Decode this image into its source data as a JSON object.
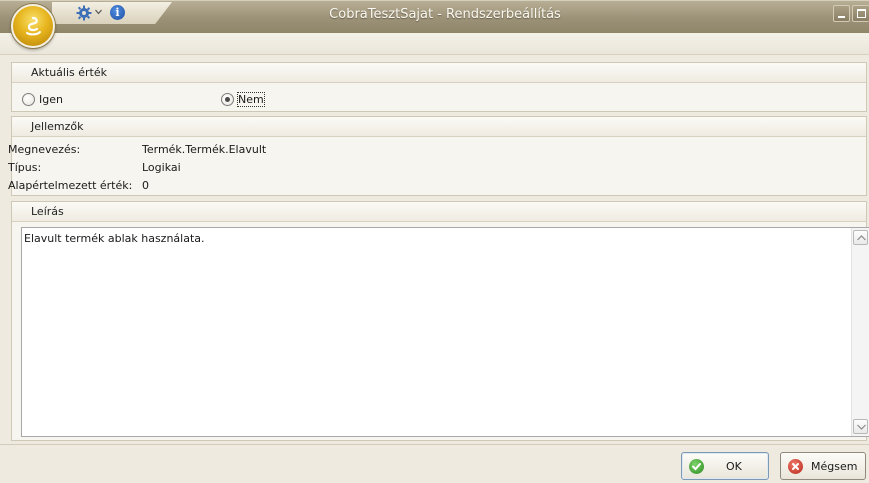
{
  "window": {
    "title": "CobraTesztSajat - Rendszerbeállítás"
  },
  "titlebar": {
    "app_icon": "app-orb-icon",
    "quick_access": [
      "gear-icon",
      "chevron-down-icon",
      "info-icon"
    ],
    "info_glyph": "i"
  },
  "current_value": {
    "header": "Aktuális érték",
    "options": [
      {
        "label": "Igen",
        "selected": false
      },
      {
        "label": "Nem",
        "selected": true
      }
    ]
  },
  "properties": {
    "header": "Jellemzők",
    "rows": [
      {
        "key": "Megnevezés:",
        "value": "Termék.Termék.Elavult"
      },
      {
        "key": "Típus:",
        "value": "Logikai"
      },
      {
        "key": "Alapértelmezett érték:",
        "value": "0"
      }
    ]
  },
  "description": {
    "header": "Leírás",
    "text": "Elavult termék ablak használata."
  },
  "buttons": {
    "ok": "OK",
    "cancel": "Mégsem"
  },
  "colors": {
    "titlebar": "#9c9278",
    "orb": "#e7b51e",
    "ok_icon": "#2d8a23",
    "cancel_icon": "#b5261a"
  }
}
